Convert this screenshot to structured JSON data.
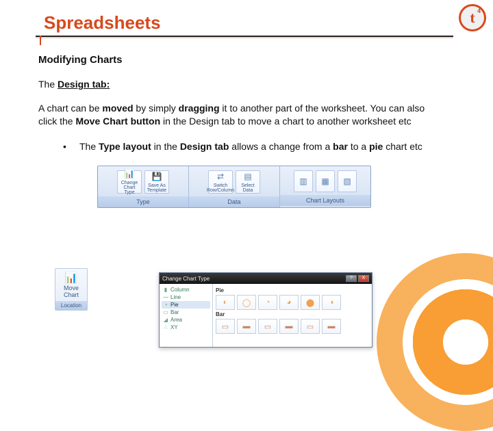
{
  "title": "Spreadsheets",
  "logo": {
    "letter": "t",
    "sup": "4"
  },
  "section": "Modifying Charts",
  "subhead_prefix": "The ",
  "subhead_bold": "Design tab:",
  "paragraph_parts": {
    "p1": "A chart can be ",
    "p2": "moved",
    "p3": " by simply ",
    "p4": "dragging",
    "p5": " it to another part of the worksheet. You can also click the ",
    "p6": "Move Chart button",
    "p7": " in the Design tab to move a chart to another worksheet etc"
  },
  "bullet": {
    "dot": "•",
    "p1": "The ",
    "p2": "Type layout",
    "p3": " in the ",
    "p4": "Design tab",
    "p5": " allows a change from a ",
    "p6": "bar",
    "p7": " to a ",
    "p8": "pie",
    "p9": " chart etc"
  },
  "ribbon": {
    "groups": [
      {
        "title": "Type",
        "buttons": [
          {
            "label": "Change Chart Type",
            "icon": "📊"
          },
          {
            "label": "Save As Template",
            "icon": "💾"
          }
        ]
      },
      {
        "title": "Data",
        "buttons": [
          {
            "label": "Switch Row/Column",
            "icon": "⇄"
          },
          {
            "label": "Select Data",
            "icon": "▤"
          }
        ]
      },
      {
        "title": "Chart Layouts",
        "buttons": [
          {
            "label": "",
            "icon": "▥"
          },
          {
            "label": "",
            "icon": "▦"
          },
          {
            "label": "",
            "icon": "▧"
          }
        ]
      }
    ]
  },
  "move_tile": {
    "label": "Move Chart",
    "footer": "Location"
  },
  "dialog": {
    "title": "Change Chart Type",
    "close": "X",
    "help": "?",
    "categories": [
      "Column",
      "Line",
      "Pie",
      "Bar",
      "Area",
      "XY"
    ],
    "selected_category": "Pie",
    "section_pie": "Pie",
    "section_bar": "Bar"
  }
}
